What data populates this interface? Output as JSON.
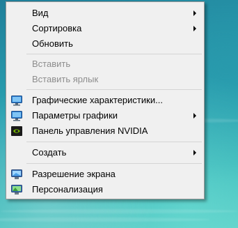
{
  "context_menu": {
    "items": [
      {
        "label": "Вид",
        "submenu": true,
        "enabled": true
      },
      {
        "label": "Сортировка",
        "submenu": true,
        "enabled": true
      },
      {
        "label": "Обновить",
        "submenu": false,
        "enabled": true
      },
      {
        "label": "Вставить",
        "submenu": false,
        "enabled": false
      },
      {
        "label": "Вставить ярлык",
        "submenu": false,
        "enabled": false
      },
      {
        "label": "Графические характеристики...",
        "submenu": false,
        "enabled": true,
        "icon": "intel-graphics-icon"
      },
      {
        "label": "Параметры графики",
        "submenu": true,
        "enabled": true,
        "icon": "intel-graphics-options-icon"
      },
      {
        "label": "Панель управления NVIDIA",
        "submenu": false,
        "enabled": true,
        "icon": "nvidia-icon"
      },
      {
        "label": "Создать",
        "submenu": true,
        "enabled": true
      },
      {
        "label": "Разрешение экрана",
        "submenu": false,
        "enabled": true,
        "icon": "display-resolution-icon"
      },
      {
        "label": "Персонализация",
        "submenu": false,
        "enabled": true,
        "icon": "personalization-icon"
      }
    ]
  },
  "colors": {
    "menu_background": "#f0f0f0",
    "disabled_text": "#8d8d8d",
    "nvidia_green": "#76b900"
  }
}
